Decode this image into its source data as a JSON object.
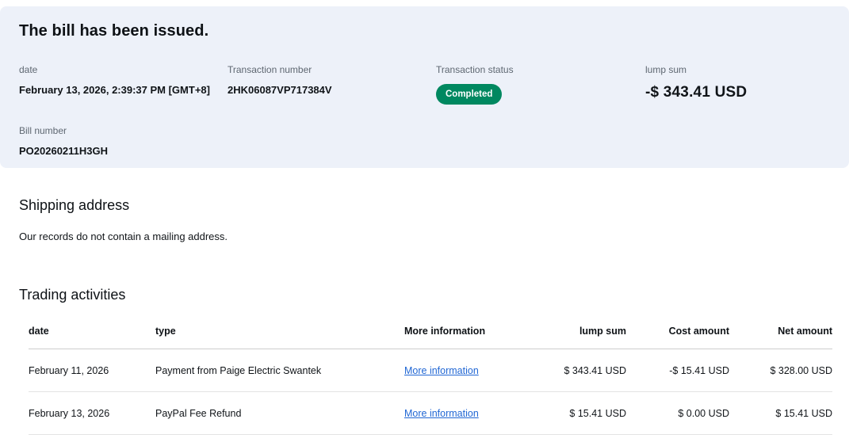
{
  "hero": {
    "title": "The bill has been issued.",
    "fields": [
      {
        "label": "date",
        "value": "February 13, 2026, 2:39:37 PM [GMT+8]"
      },
      {
        "label": "Transaction number",
        "value": "2HK06087VP717384V"
      },
      {
        "label": "Transaction status",
        "badge": "Completed"
      },
      {
        "label": "lump sum",
        "value": "-$ 343.41 USD"
      }
    ],
    "bill": {
      "label": "Bill number",
      "value": "PO20260211H3GH"
    }
  },
  "shipping": {
    "title": "Shipping address",
    "message": "Our records do not contain a mailing address."
  },
  "activities": {
    "title": "Trading activities",
    "columns": [
      "date",
      "type",
      "More information",
      "lump sum",
      "Cost amount",
      "Net amount"
    ],
    "rows": [
      {
        "date": "February 11, 2026",
        "type": "Payment from Paige Electric Swantek",
        "more": "More information",
        "lump": "$ 343.41 USD",
        "cost": "-$ 15.41 USD",
        "net": "$ 328.00 USD"
      },
      {
        "date": "February 13, 2026",
        "type": "PayPal Fee Refund",
        "more": "More information",
        "lump": "$ 15.41 USD",
        "cost": "$ 0.00 USD",
        "net": "$ 15.41 USD"
      }
    ]
  },
  "colors": {
    "hero_background": "#edf1f9",
    "status_green": "#008860",
    "link_blue": "#2167d4"
  }
}
